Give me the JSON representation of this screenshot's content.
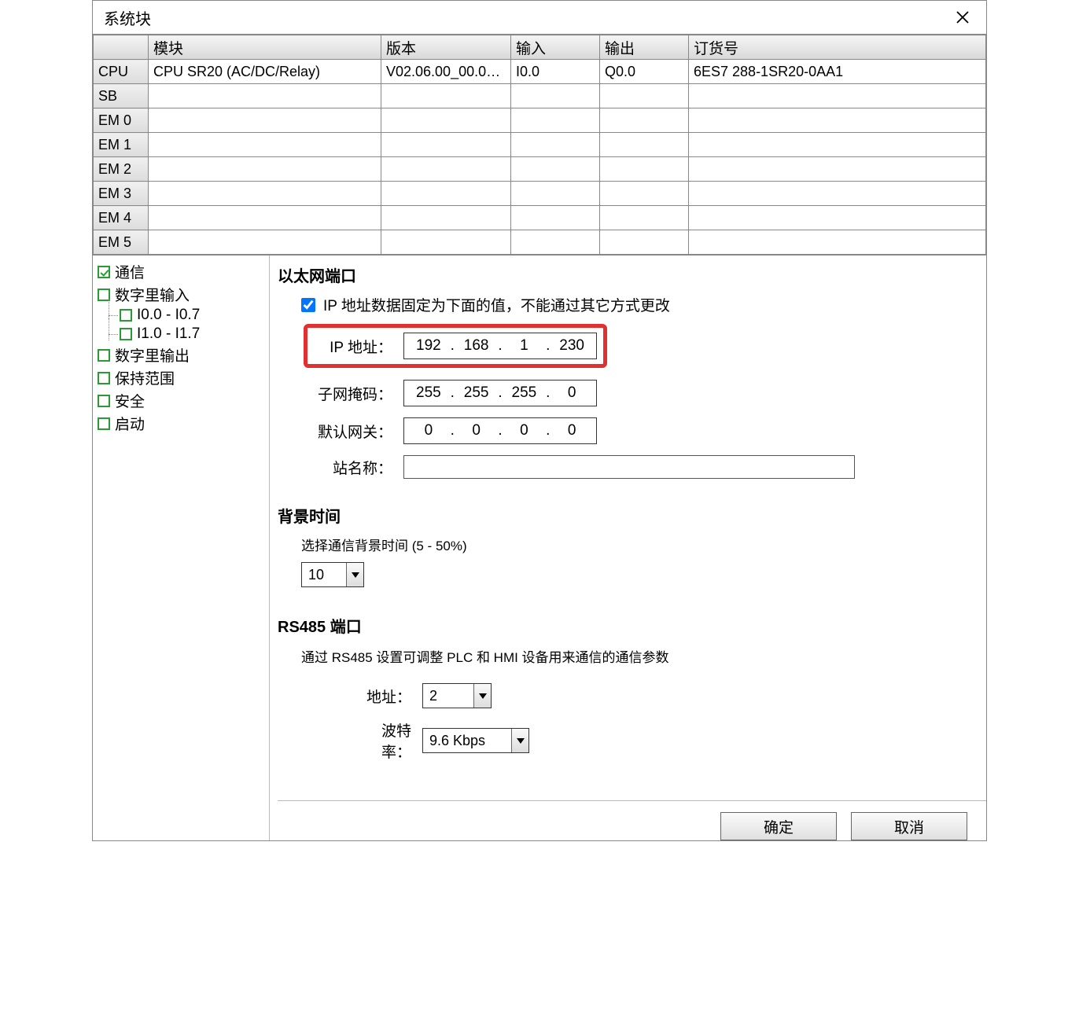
{
  "title": "系统块",
  "table": {
    "headers": [
      "",
      "模块",
      "版本",
      "输入",
      "输出",
      "订货号"
    ],
    "rows": [
      {
        "label": "CPU",
        "module": "CPU SR20 (AC/DC/Relay)",
        "version": "V02.06.00_00.00...",
        "input": "I0.0",
        "output": "Q0.0",
        "order": "6ES7 288-1SR20-0AA1",
        "highlight": true
      },
      {
        "label": "SB",
        "module": "",
        "version": "",
        "input": "",
        "output": "",
        "order": ""
      },
      {
        "label": "EM 0",
        "module": "",
        "version": "",
        "input": "",
        "output": "",
        "order": ""
      },
      {
        "label": "EM 1",
        "module": "",
        "version": "",
        "input": "",
        "output": "",
        "order": ""
      },
      {
        "label": "EM 2",
        "module": "",
        "version": "",
        "input": "",
        "output": "",
        "order": ""
      },
      {
        "label": "EM 3",
        "module": "",
        "version": "",
        "input": "",
        "output": "",
        "order": ""
      },
      {
        "label": "EM 4",
        "module": "",
        "version": "",
        "input": "",
        "output": "",
        "order": ""
      },
      {
        "label": "EM 5",
        "module": "",
        "version": "",
        "input": "",
        "output": "",
        "order": ""
      }
    ]
  },
  "tree": {
    "items": [
      {
        "label": "通信",
        "checked": true
      },
      {
        "label": "数字里输入"
      },
      {
        "label": "I0.0 - I0.7",
        "child": true
      },
      {
        "label": "I1.0 - I1.7",
        "child": true
      },
      {
        "label": "数字里输出"
      },
      {
        "label": "保持范围"
      },
      {
        "label": "安全"
      },
      {
        "label": "启动"
      }
    ]
  },
  "ethernet": {
    "heading": "以太网端口",
    "fixed_label": "IP 地址数据固定为下面的值，不能通过其它方式更改",
    "ip_label": "IP 地址：",
    "ip": [
      "192",
      "168",
      "1",
      "230"
    ],
    "mask_label": "子网掩码：",
    "mask": [
      "255",
      "255",
      "255",
      "0"
    ],
    "gateway_label": "默认网关：",
    "gateway": [
      "0",
      "0",
      "0",
      "0"
    ],
    "station_label": "站名称：",
    "station": ""
  },
  "bgtime": {
    "heading": "背景时间",
    "desc": "选择通信背景时间 (5 - 50%)",
    "value": "10"
  },
  "rs485": {
    "heading": "RS485 端口",
    "desc": "通过 RS485 设置可调整 PLC 和 HMI 设备用来通信的通信参数",
    "addr_label": "地址：",
    "addr": "2",
    "baud_label": "波特率：",
    "baud": "9.6 Kbps"
  },
  "buttons": {
    "ok": "确定",
    "cancel": "取消"
  }
}
